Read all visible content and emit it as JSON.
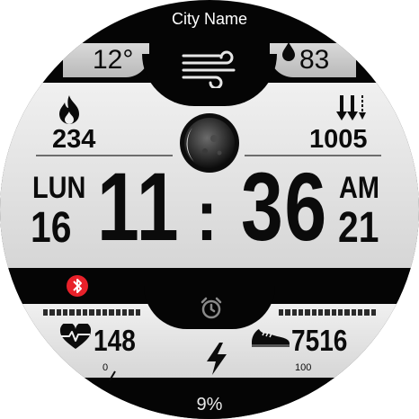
{
  "header": {
    "city": "City Name"
  },
  "weather": {
    "temperature": "12°",
    "humidity": "83",
    "wind_icon": "wind-icon",
    "drop_icon": "drop-icon"
  },
  "stats": {
    "calories": "234",
    "pressure": "1005",
    "calorie_icon": "flame-icon",
    "pressure_icon": "pressure-arrows-icon"
  },
  "time": {
    "day": "LUN",
    "date": "16",
    "hour": "11",
    "separator": ":",
    "minute": "36",
    "ampm": "AM",
    "seconds": "21"
  },
  "moon": {
    "icon": "moon-phase-icon"
  },
  "status": {
    "bluetooth_icon": "bluetooth-icon",
    "alarm_icon": "alarm-icon",
    "bluetooth_color": "#e8212a"
  },
  "health": {
    "heart_rate": "148",
    "steps": "7516",
    "steps_scale_min": "0",
    "steps_scale_max": "100",
    "heart_icon": "heart-pulse-icon",
    "shoe_icon": "shoe-icon",
    "charge_icon": "lightning-icon"
  },
  "battery": {
    "level": "9%"
  }
}
